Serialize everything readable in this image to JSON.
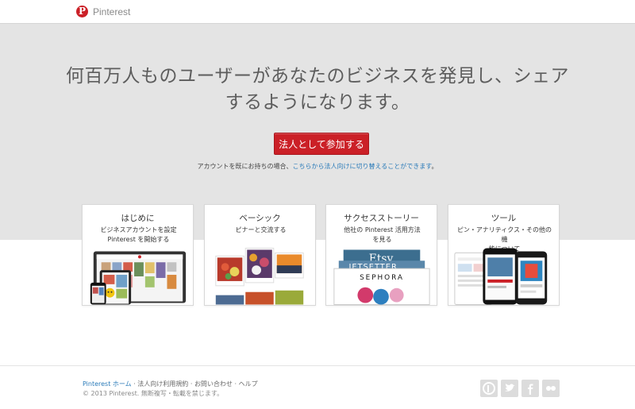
{
  "header": {
    "logo_text": "Pinterest",
    "logo_glyph": "P"
  },
  "hero": {
    "headline_line1": "何百万人ものユーザーがあなたのビジネスを発見し、シェア",
    "headline_line2": "するようになります。",
    "cta_label": "法人として参加する",
    "note_prefix": "アカウントを既にお持ちの場合、",
    "note_link": "こちらから法人向けに切り替えることができます",
    "note_suffix": "。"
  },
  "cards": [
    {
      "title": "はじめに",
      "desc_line1": "ビジネスアカウントを設定",
      "desc_line2": "Pinterest を開始する"
    },
    {
      "title": "ベーシック",
      "desc_line1": "ピナーと交流する",
      "desc_line2": ""
    },
    {
      "title": "サクセスストーリー",
      "desc_line1": "他社の Pinterest 活用方法",
      "desc_line2": "を見る",
      "art_brand_1": "Etsy",
      "art_brand_2": "JETSETTER",
      "art_brand_3": "SEPHORA"
    },
    {
      "title": "ツール",
      "desc_line1": "ピン・アナリティクス・その他の機",
      "desc_line2": "能について"
    }
  ],
  "footer": {
    "home_link": "Pinterest ホーム",
    "sep": " · ",
    "terms": "法人向け利用規約",
    "contact": "お問い合わせ",
    "help": "ヘルプ",
    "copyright": "© 2013 Pinterest. 無断複写・転載を禁じます。"
  },
  "social_icons": [
    "pinterest-icon",
    "twitter-icon",
    "facebook-icon",
    "flickr-icon"
  ],
  "colors": {
    "brand_red": "#cb2027",
    "link_blue": "#2b7bb9",
    "hero_bg": "#e4e4e4",
    "social_gray": "#dcdcdc"
  }
}
